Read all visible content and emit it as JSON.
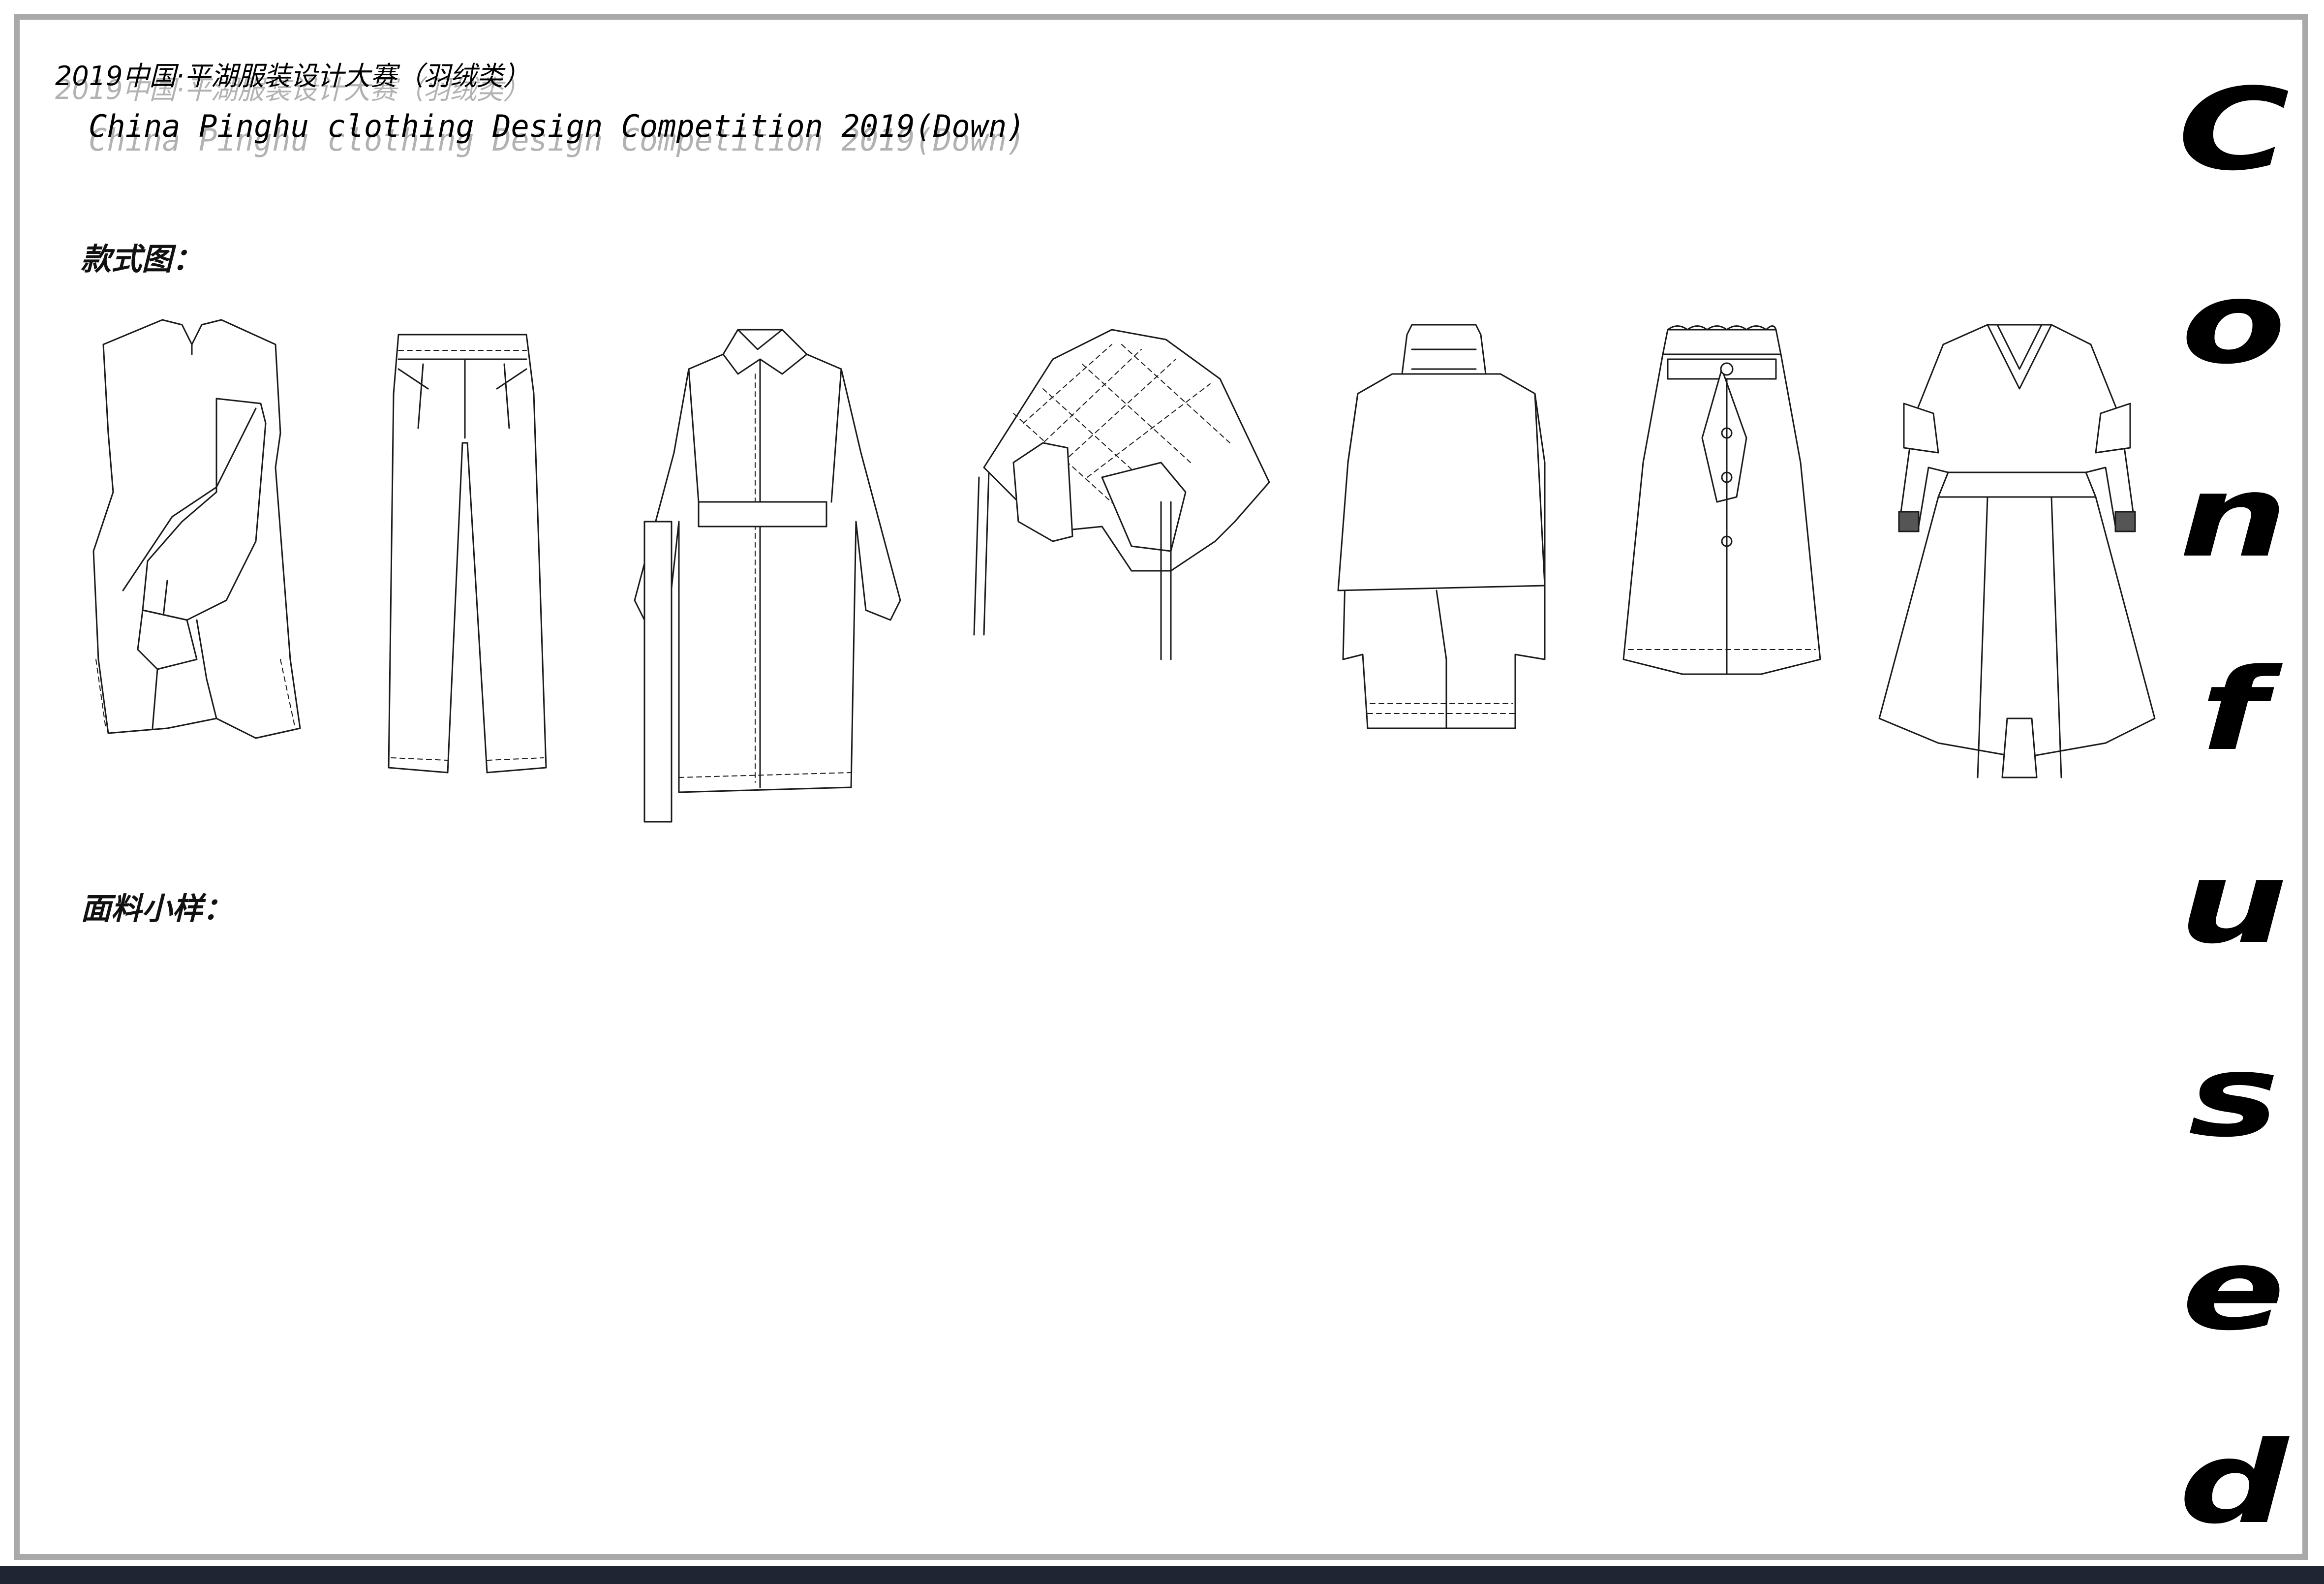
{
  "header": {
    "title_cn": "2019中国·平湖服装设计大赛（羽绒类）",
    "title_en": "China Pinghu clothing Design Competition 2019(Down)"
  },
  "sections": {
    "styles_label": "款式图：",
    "fabric_label": "面料小样："
  },
  "collection_word": [
    "C",
    "o",
    "n",
    "f",
    "u",
    "s",
    "e",
    "d"
  ],
  "garments": [
    "draped-wrap-dress",
    "pleated-trousers",
    "belted-long-coat",
    "quilted-down-cape",
    "cowl-neck-poncho",
    "paperbag-skirt",
    "bomber-top-full-skirt"
  ],
  "colors": {
    "frame": "#a9a9a9",
    "ink": "#1a1a1a",
    "bottom_bar": "#1f2533"
  }
}
